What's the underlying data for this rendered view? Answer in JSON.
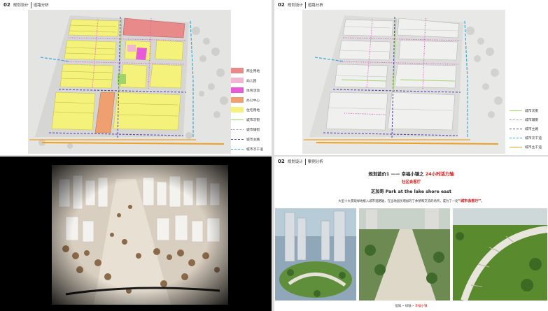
{
  "panel_top_left": {
    "header_num": "02",
    "header_a": "规划设计",
    "header_b": "道路分析",
    "legend": [
      {
        "label": "商业用地",
        "color": "#e88a8a",
        "kind": "swatch"
      },
      {
        "label": "幼儿园",
        "color": "#f2b6d0",
        "kind": "swatch"
      },
      {
        "label": "体育活动",
        "color": "#e85ad8",
        "kind": "swatch"
      },
      {
        "label": "办公中心",
        "color": "#f0a070",
        "kind": "swatch"
      },
      {
        "label": "住宅用地",
        "color": "#f4f27a",
        "kind": "swatch"
      },
      {
        "label": "城市次街",
        "color": "#9fd46a",
        "kind": "line"
      },
      {
        "label": "城市辅街",
        "color": "#e05ac8",
        "kind": "dotted"
      },
      {
        "label": "城市主路",
        "color": "#5a4ab8",
        "kind": "dashed"
      },
      {
        "label": "城市次干道",
        "color": "#3aa8d8",
        "kind": "dashed"
      },
      {
        "label": "城市主干道",
        "color": "#f0a020",
        "kind": "line"
      }
    ]
  },
  "panel_top_right": {
    "header_num": "02",
    "header_a": "规划设计",
    "header_b": "道路分析",
    "legend": [
      {
        "label": "城市次街",
        "color": "#9fd46a",
        "kind": "line"
      },
      {
        "label": "城市辅街",
        "color": "#e05ac8",
        "kind": "dotted"
      },
      {
        "label": "城市主路",
        "color": "#5a4ab8",
        "kind": "dashed"
      },
      {
        "label": "城市次干道",
        "color": "#3aa8d8",
        "kind": "dashed"
      },
      {
        "label": "城市主干道",
        "color": "#f0a020",
        "kind": "line"
      }
    ]
  },
  "panel_bottom_right": {
    "header_num": "02",
    "header_a": "规划设计",
    "header_b": "案例分析",
    "title_prefix": "规划蓝价1 —— 幸福小镇之",
    "title_highlight": "24小时活力轴",
    "subtitle": "社区会客厅",
    "park_title": "芝加哥 Park at the lake shore east",
    "desc_prefix": "大型十大景观绿地植入城市道路轴，在当地居民增加的了休憩和交流的场所，成为了一处",
    "desc_highlight": "“城市会客厅”",
    "desc_suffix": "。",
    "footer_prefix": "宿知 • 绿轴 •",
    "footer_highlight": "幸福小镇"
  }
}
